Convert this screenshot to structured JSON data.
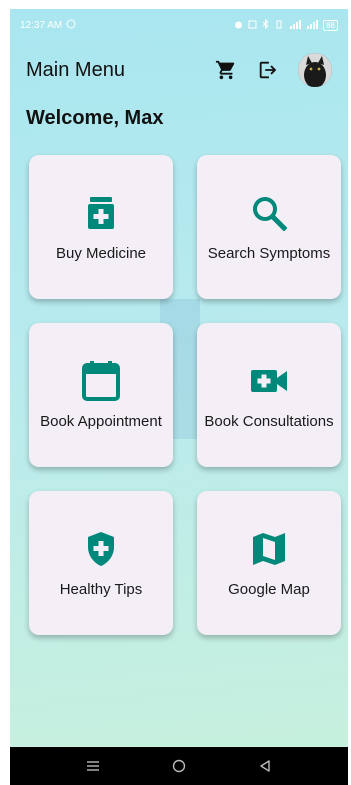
{
  "status_bar": {
    "time": "12:37 AM",
    "battery": "88"
  },
  "header": {
    "title": "Main Menu",
    "cart_icon": "cart-icon",
    "logout_icon": "logout-icon"
  },
  "welcome": "Welcome, Max",
  "menu": [
    {
      "label": "Buy Medicine",
      "icon": "medicine-bottle-icon"
    },
    {
      "label": "Search Symptoms",
      "icon": "search-icon"
    },
    {
      "label": "Book Appointment",
      "icon": "calendar-icon"
    },
    {
      "label": "Book Consultations",
      "icon": "video-plus-icon"
    },
    {
      "label": "Healthy Tips",
      "icon": "shield-plus-icon"
    },
    {
      "label": "Google Map",
      "icon": "map-icon"
    }
  ],
  "colors": {
    "accent": "#00897b",
    "card_bg": "#f4eff6"
  }
}
